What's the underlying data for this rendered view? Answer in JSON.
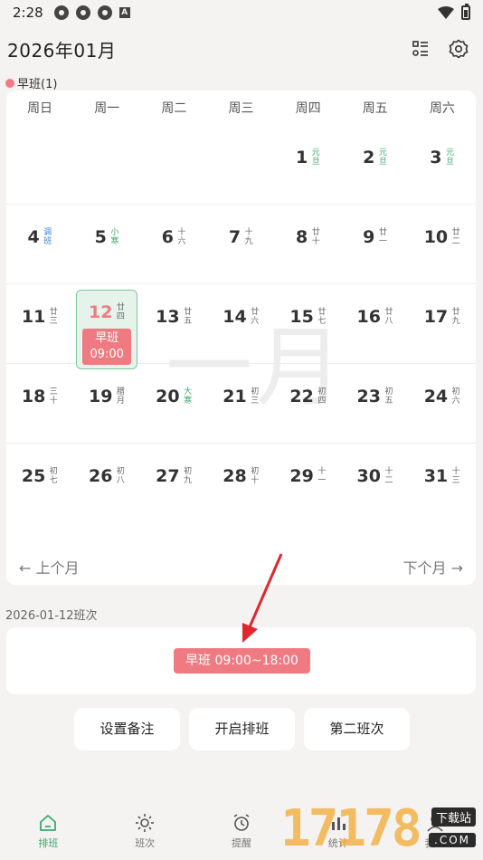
{
  "status": {
    "time": "2:28"
  },
  "header": {
    "title": "2026年01月"
  },
  "legend": {
    "label": "早班(1)"
  },
  "calendar": {
    "weekdays": [
      "周日",
      "周一",
      "周二",
      "周三",
      "周四",
      "周五",
      "周六"
    ],
    "watermark": "一月",
    "days": [
      {
        "n": "1",
        "l": "元旦",
        "c": "green"
      },
      {
        "n": "2",
        "l": "元旦",
        "c": "green"
      },
      {
        "n": "3",
        "l": "元旦",
        "c": "green"
      },
      {
        "n": "4",
        "l": "调班",
        "c": "blue"
      },
      {
        "n": "5",
        "l": "小寒",
        "c": "green"
      },
      {
        "n": "6",
        "l": "十六",
        "c": ""
      },
      {
        "n": "7",
        "l": "十九",
        "c": ""
      },
      {
        "n": "8",
        "l": "廿十",
        "c": ""
      },
      {
        "n": "9",
        "l": "廿一",
        "c": ""
      },
      {
        "n": "10",
        "l": "廿二",
        "c": ""
      },
      {
        "n": "11",
        "l": "廿三",
        "c": ""
      },
      {
        "n": "12",
        "l": "廿四",
        "c": ""
      },
      {
        "n": "13",
        "l": "廿五",
        "c": ""
      },
      {
        "n": "14",
        "l": "廿六",
        "c": ""
      },
      {
        "n": "15",
        "l": "廿七",
        "c": ""
      },
      {
        "n": "16",
        "l": "廿八",
        "c": ""
      },
      {
        "n": "17",
        "l": "廿九",
        "c": ""
      },
      {
        "n": "18",
        "l": "三十",
        "c": ""
      },
      {
        "n": "19",
        "l": "腊月",
        "c": ""
      },
      {
        "n": "20",
        "l": "大寒",
        "c": "green"
      },
      {
        "n": "21",
        "l": "初三",
        "c": ""
      },
      {
        "n": "22",
        "l": "初四",
        "c": ""
      },
      {
        "n": "23",
        "l": "初五",
        "c": ""
      },
      {
        "n": "24",
        "l": "初六",
        "c": ""
      },
      {
        "n": "25",
        "l": "初七",
        "c": ""
      },
      {
        "n": "26",
        "l": "初八",
        "c": ""
      },
      {
        "n": "27",
        "l": "初九",
        "c": ""
      },
      {
        "n": "28",
        "l": "初十",
        "c": ""
      },
      {
        "n": "29",
        "l": "十一",
        "c": ""
      },
      {
        "n": "30",
        "l": "十二",
        "c": ""
      },
      {
        "n": "31",
        "l": "十三",
        "c": ""
      }
    ],
    "today_shift": {
      "name": "早班",
      "time": "09:00"
    },
    "prev_label": "← 上个月",
    "next_label": "下个月 →"
  },
  "selected": {
    "date_label": "2026-01-12班次",
    "shift_label": "早班   09:00~18:00"
  },
  "actions": {
    "note": "设置备注",
    "schedule": "开启排班",
    "second": "第二班次"
  },
  "tabs": [
    "排班",
    "班次",
    "提醒",
    "统计",
    "我的"
  ],
  "watermark_logo": {
    "digits": "17178",
    "sub1": "下载站",
    "sub2": ".COM"
  },
  "colors": {
    "accent": "#3aa86b",
    "shift": "#f07a82",
    "today_bg": "#e5f3ea"
  }
}
